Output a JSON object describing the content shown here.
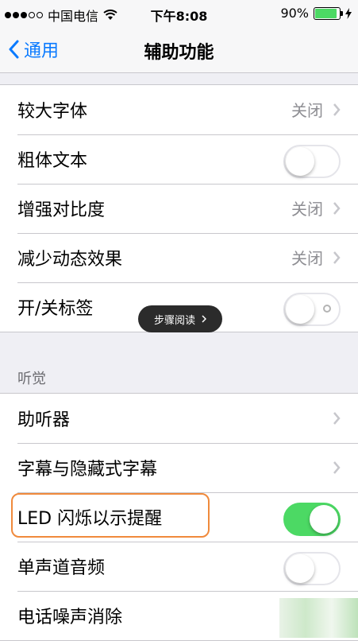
{
  "status_bar": {
    "carrier": "中国电信",
    "time": "下午8:08",
    "battery": "90%",
    "battery_level": 0.9
  },
  "nav": {
    "back_label": "通用",
    "title": "辅助功能"
  },
  "vision_rows": [
    {
      "label": "较大字体",
      "value": "关闭"
    },
    {
      "label": "粗体文本",
      "switch": "off"
    },
    {
      "label": "增强对比度",
      "value": "关闭"
    },
    {
      "label": "减少动态效果",
      "value": "关闭"
    },
    {
      "label": "开/关标签",
      "switch": "off"
    }
  ],
  "hearing": {
    "header": "听觉",
    "rows": [
      {
        "label": "助听器"
      },
      {
        "label": "字幕与隐藏式字幕"
      },
      {
        "label": "LED 闪烁以示提醒",
        "switch": "on"
      },
      {
        "label": "单声道音频",
        "switch": "off"
      },
      {
        "label": "电话噪声消除",
        "switch": "off"
      }
    ]
  },
  "overlay": {
    "label": "步骤阅读"
  },
  "colors": {
    "accent": "#0a7aff",
    "switch_on": "#4cd964",
    "highlight": "#f08a3c"
  }
}
